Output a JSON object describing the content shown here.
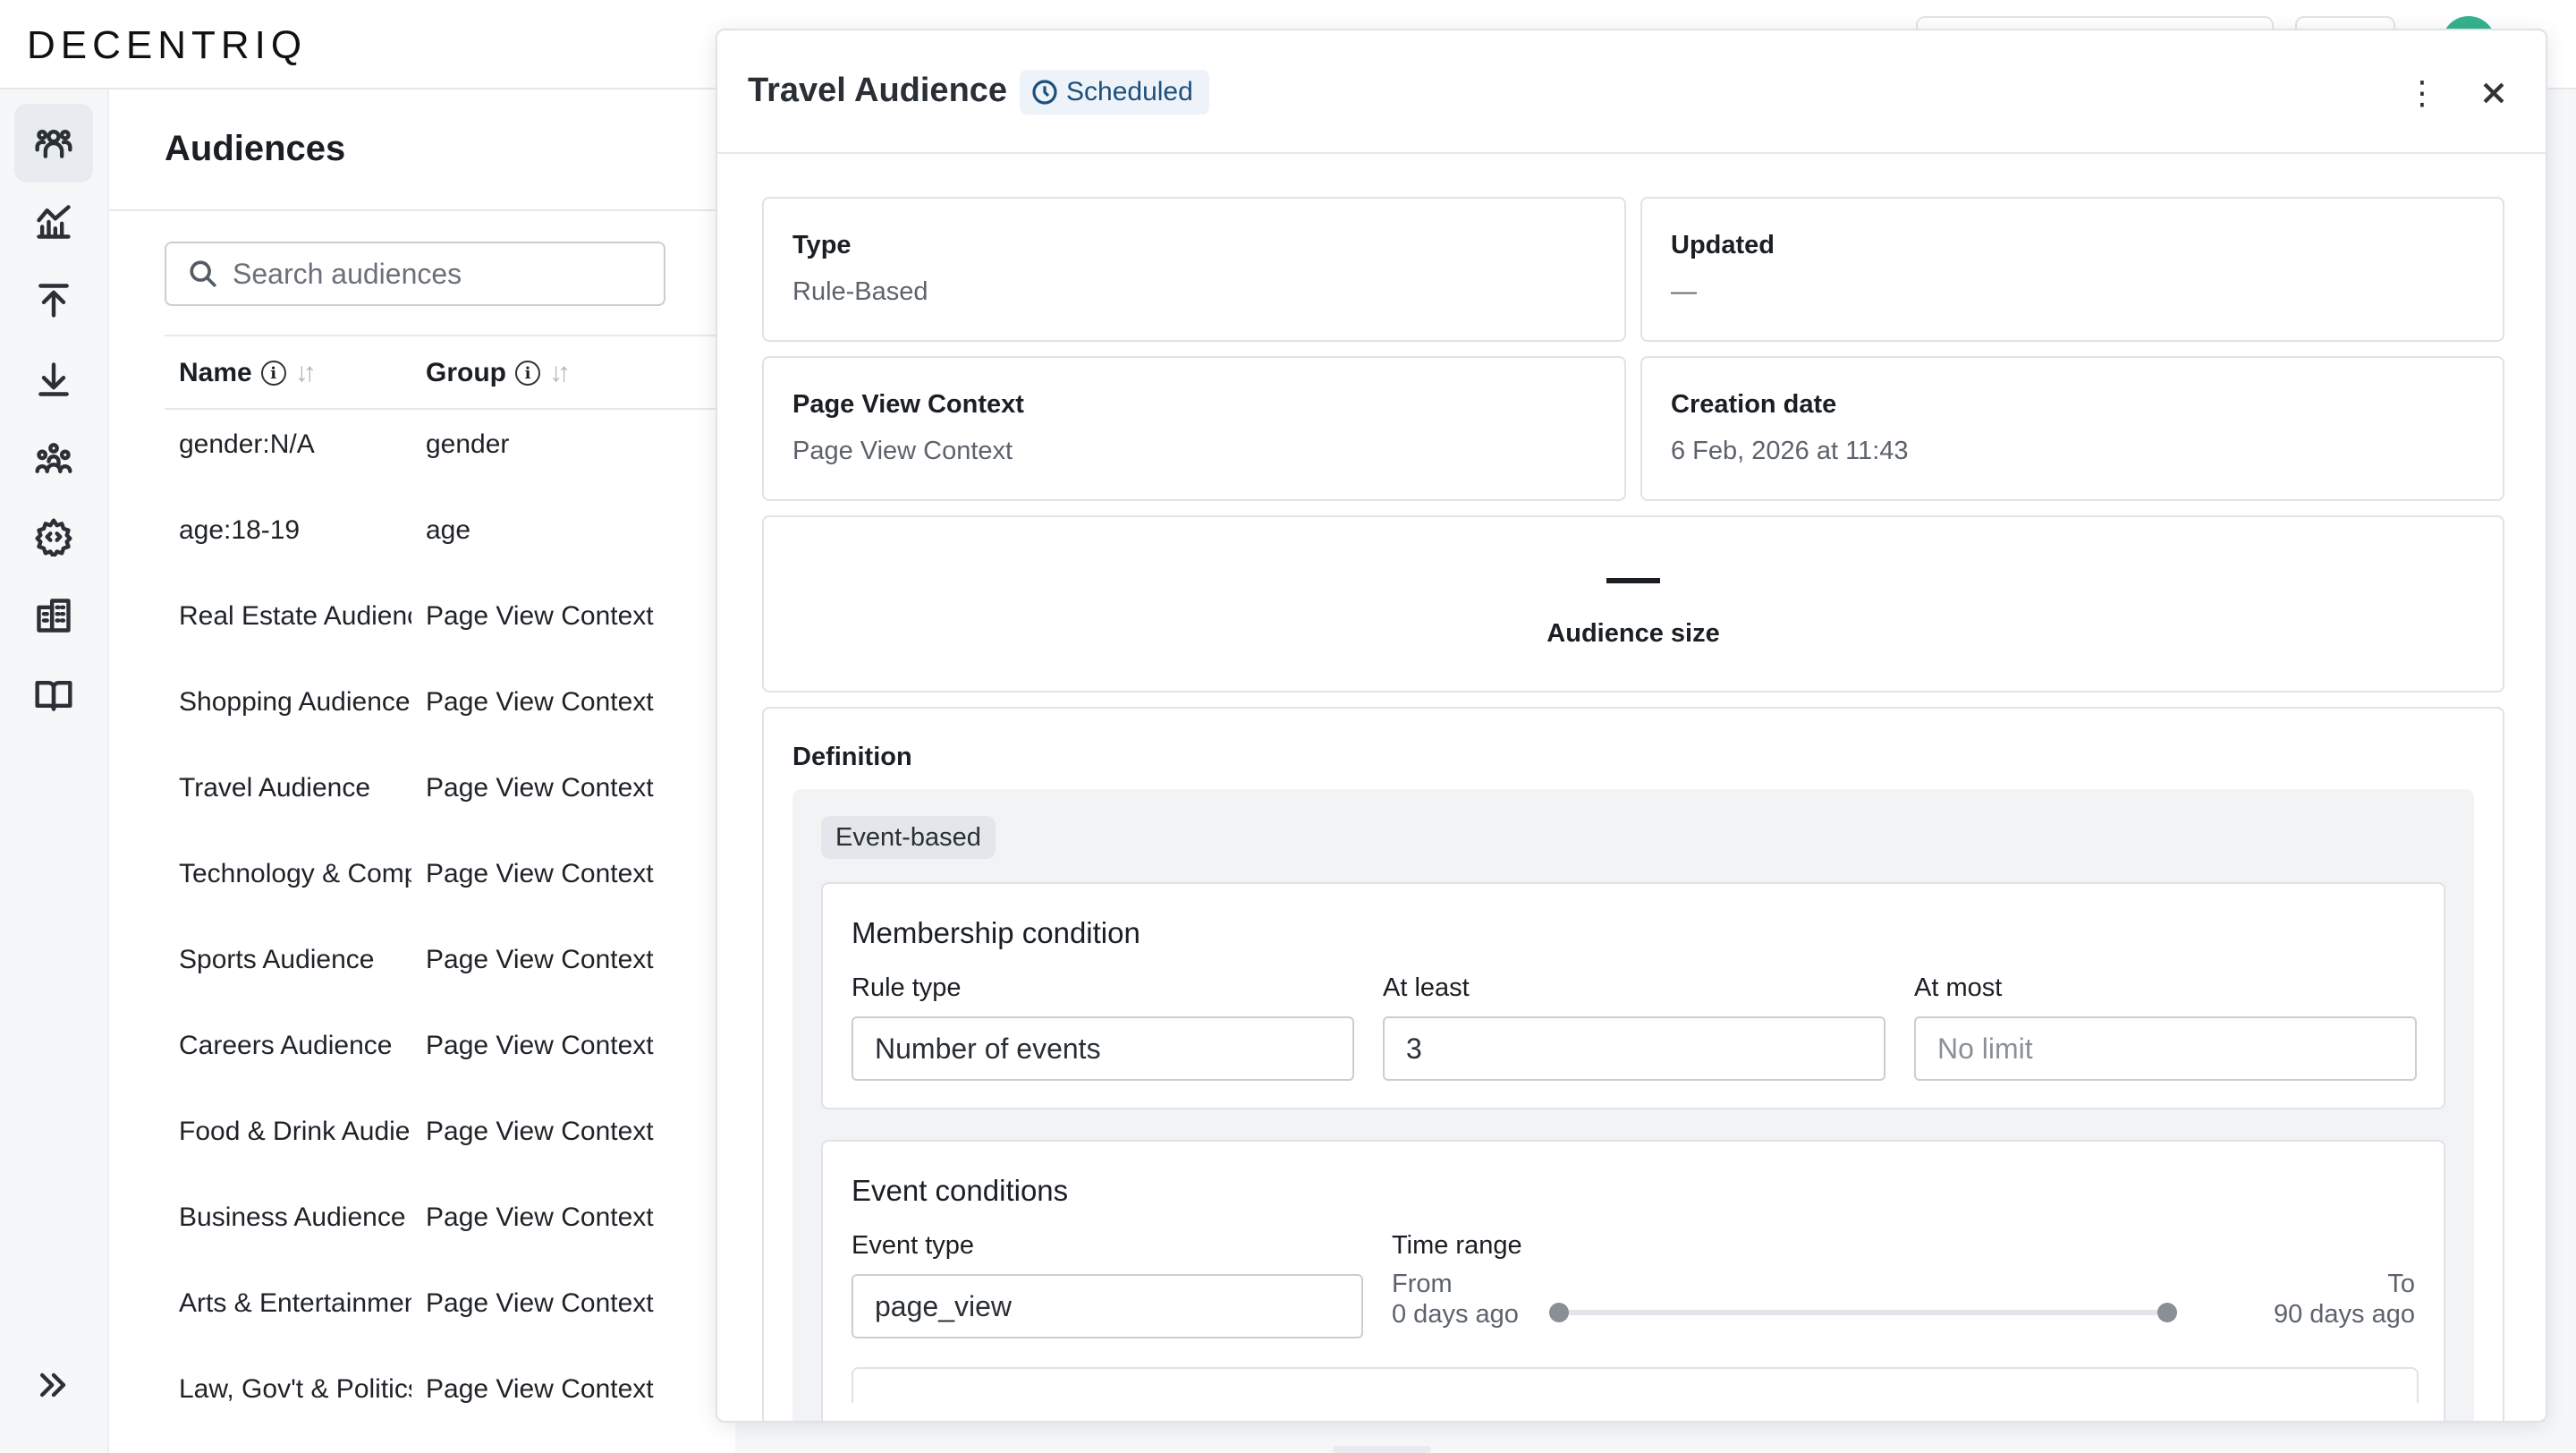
{
  "brand": {
    "logo_text": "DECENTRIQ"
  },
  "sidebar": {
    "items": [
      {
        "icon": "audiences-icon",
        "active": true
      },
      {
        "icon": "insights-chart-icon",
        "active": false
      },
      {
        "icon": "upload-icon",
        "active": false
      },
      {
        "icon": "download-icon",
        "active": false
      },
      {
        "icon": "people-group-icon",
        "active": false
      },
      {
        "icon": "settings-code-icon",
        "active": false
      },
      {
        "icon": "organization-building-icon",
        "active": false
      },
      {
        "icon": "book-icon",
        "active": false
      }
    ],
    "expand_icon": "double-chevron-right-icon"
  },
  "audiences_list": {
    "title": "Audiences",
    "search_placeholder": "Search audiences",
    "columns": {
      "name": "Name",
      "group": "Group"
    },
    "rows": [
      {
        "name": "gender:N/A",
        "group": "gender"
      },
      {
        "name": "age:18-19",
        "group": "age"
      },
      {
        "name": "Real Estate Audience",
        "group": "Page View Context"
      },
      {
        "name": "Shopping Audience",
        "group": "Page View Context"
      },
      {
        "name": "Travel Audience",
        "group": "Page View Context"
      },
      {
        "name": "Technology & Computing",
        "group": "Page View Context"
      },
      {
        "name": "Sports Audience",
        "group": "Page View Context"
      },
      {
        "name": "Careers Audience",
        "group": "Page View Context"
      },
      {
        "name": "Food & Drink Audience",
        "group": "Page View Context"
      },
      {
        "name": "Business Audience",
        "group": "Page View Context"
      },
      {
        "name": "Arts & Entertainment",
        "group": "Page View Context"
      },
      {
        "name": "Law, Gov't & Politics",
        "group": "Page View Context"
      }
    ]
  },
  "drawer": {
    "title": "Travel Audience",
    "status": "Scheduled",
    "type": {
      "label": "Type",
      "value": "Rule-Based"
    },
    "updated": {
      "label": "Updated",
      "value": "—"
    },
    "group": {
      "label": "Page View Context",
      "value": "Page View Context"
    },
    "created": {
      "label": "Creation date",
      "value": "6 Feb, 2026 at 11:43"
    },
    "audience_size": {
      "label": "Audience size"
    },
    "definition": {
      "title": "Definition",
      "chip": "Event-based",
      "membership": {
        "title": "Membership condition",
        "rule_type_label": "Rule type",
        "rule_type_value": "Number of events",
        "at_least_label": "At least",
        "at_least_value": "3",
        "at_most_label": "At most",
        "at_most_placeholder": "No limit"
      },
      "events": {
        "title": "Event conditions",
        "event_type_label": "Event type",
        "event_type_value": "page_view",
        "time_range_label": "Time range",
        "from_label": "From",
        "from_value": "0 days ago",
        "to_label": "To",
        "to_value": "90 days ago"
      }
    }
  }
}
